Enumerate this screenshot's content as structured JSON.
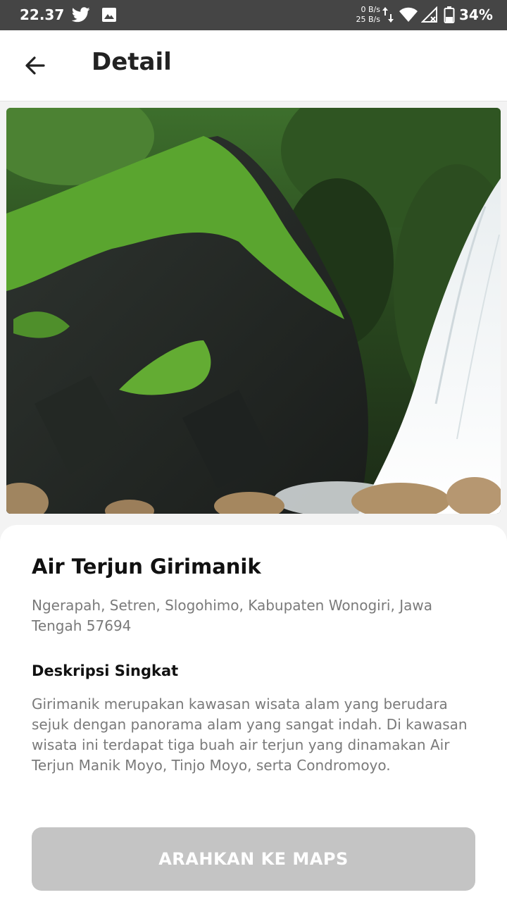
{
  "status_bar": {
    "time": "22.37",
    "net_up": "0 B/s",
    "net_down": "25 B/s",
    "battery": "34%",
    "icons": [
      "twitter-icon",
      "image-icon",
      "data-arrows-icon",
      "wifi-icon",
      "signal-icon",
      "battery-icon"
    ]
  },
  "header": {
    "back_icon": "arrow-left-icon",
    "title": "Detail"
  },
  "place": {
    "name": "Air Terjun Girimanik",
    "address": "Ngerapah, Setren, Slogohimo, Kabupaten Wonogiri, Jawa Tengah 57694",
    "description_heading": "Deskripsi Singkat",
    "description": "Girimanik merupakan kawasan wisata alam yang berudara sejuk dengan panorama alam yang sangat indah. Di kawasan wisata ini terdapat tiga buah air terjun yang dinamakan Air Terjun Manik Moyo, Tinjo Moyo, serta Condromoyo."
  },
  "actions": {
    "maps_button": "ARAHKAN KE MAPS"
  },
  "colors": {
    "status_bar": "#454545",
    "button_disabled": "#c4c4c4",
    "secondary_text": "#7a7a7a"
  }
}
